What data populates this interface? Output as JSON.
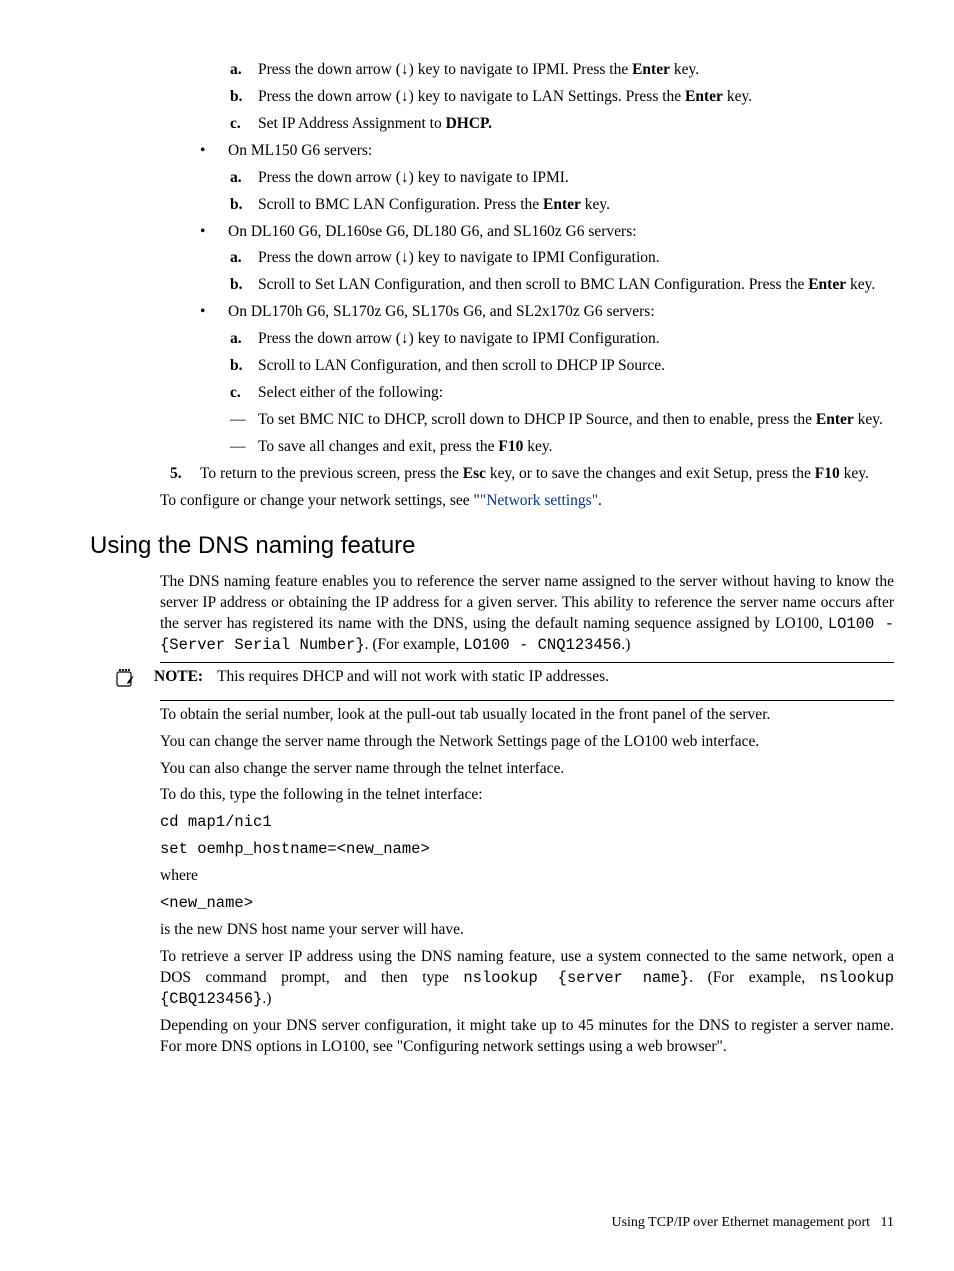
{
  "step4": {
    "abc1": {
      "a": {
        "mk": "a.",
        "pre": "Press the down arrow (↓) key to navigate to IPMI. Press the ",
        "bold": "Enter",
        "post": " key."
      },
      "b": {
        "mk": "b.",
        "pre": "Press the down arrow (↓) key to navigate to LAN Settings. Press the ",
        "bold": "Enter",
        "post": " key."
      },
      "c": {
        "mk": "c.",
        "pre": "Set IP Address Assignment to ",
        "bold": "DHCP.",
        "post": ""
      }
    },
    "bul2": {
      "text": "On ML150 G6 servers:"
    },
    "abc2": {
      "a": {
        "mk": "a.",
        "text": "Press the down arrow (↓) key to navigate to IPMI."
      },
      "b": {
        "mk": "b.",
        "pre": "Scroll to BMC LAN Configuration. Press the ",
        "bold": "Enter",
        "post": " key."
      }
    },
    "bul3": {
      "text": "On DL160 G6, DL160se G6, DL180 G6, and SL160z G6 servers:"
    },
    "abc3": {
      "a": {
        "mk": "a.",
        "text": "Press the down arrow (↓) key to navigate to IPMI Configuration."
      },
      "b": {
        "mk": "b.",
        "pre": "Scroll to Set LAN Configuration, and then scroll to BMC LAN Configuration. Press the ",
        "bold": "Enter",
        "post": " key."
      }
    },
    "bul4": {
      "text": "On DL170h G6, SL170z G6, SL170s G6, and SL2x170z G6 servers:"
    },
    "abc4": {
      "a": {
        "mk": "a.",
        "text": "Press the down arrow (↓) key to navigate to IPMI Configuration."
      },
      "b": {
        "mk": "b.",
        "text": "Scroll to LAN Configuration, and then scroll to DHCP IP Source."
      },
      "c": {
        "mk": "c.",
        "text": "Select either of the following:"
      }
    },
    "dash4": {
      "d1": {
        "pre": "To set BMC NIC to DHCP, scroll down to DHCP IP Source, and then to enable, press the ",
        "bold": "Enter",
        "post": " key."
      },
      "d2": {
        "pre": "To save all changes and exit, press the ",
        "bold": "F10",
        "post": " key."
      }
    }
  },
  "step5": {
    "mk": "5.",
    "pre1": "To return to the previous screen, press the ",
    "bold1": "Esc",
    "mid": " key, or to save the changes and exit Setup, press the ",
    "bold2": "F10",
    "post": " key."
  },
  "configLine": {
    "pre": "To configure or change your network settings, see \"",
    "link": "\"Network settings\"",
    "post": "."
  },
  "heading": "Using the DNS naming feature",
  "dns_p1": {
    "pre": "The DNS naming feature enables you to reference the server name assigned to the server without having to know the server IP address or obtaining the IP address for a given server. This ability to reference the server name occurs after the server has registered its name with the DNS, using the default naming sequence assigned by LO100, ",
    "code1": "LO100 - {Server Serial Number}",
    "mid": ". (For example, ",
    "code2": "LO100 - CNQ123456",
    "post": ".)"
  },
  "note": {
    "label": "NOTE:",
    "text": "This requires DHCP and will not work with static IP addresses."
  },
  "p2": "To obtain the serial number, look at the pull-out tab usually located in the front panel of the server.",
  "p3": "You can change the server name through the Network Settings page of the LO100 web interface.",
  "p4": "You can also change the server name through the telnet interface.",
  "p5": "To do this, type the following in the telnet interface:",
  "cmd1": "cd map1/nic1",
  "cmd2": "set oemhp_hostname=<new_name>",
  "p_where": "where",
  "cmd3": "<new_name>",
  "p6": "is the new DNS host name your server will have.",
  "p7": {
    "pre": "To retrieve a server IP address using the DNS naming feature, use a system connected to the same network, open a DOS command prompt, and then type ",
    "code1": "nslookup {server name}",
    "mid": ". (For example, ",
    "code2": "nslookup {CBQ123456}",
    "post": ".)"
  },
  "p8": "Depending on your DNS server configuration, it might take up to 45 minutes for the DNS to register a server name. For more DNS options in LO100, see \"Configuring network settings using a web browser\".",
  "footer": {
    "text": "Using TCP/IP over Ethernet management port",
    "page": "11"
  }
}
